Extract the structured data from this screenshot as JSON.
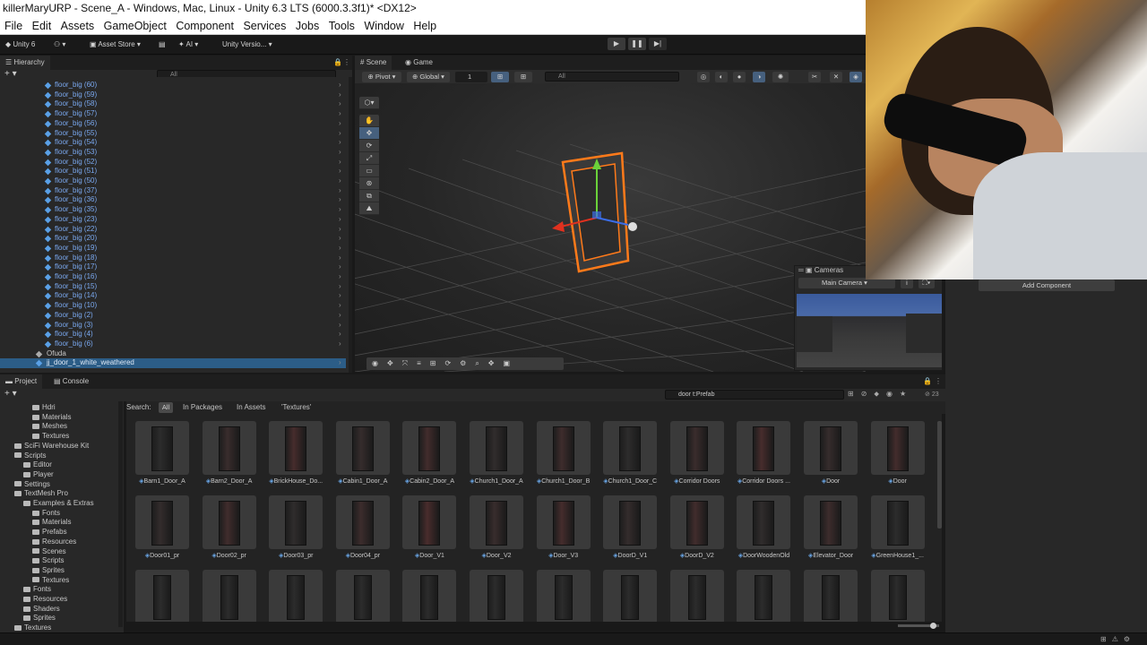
{
  "title": "killerMaryURP - Scene_A - Windows, Mac, Linux - Unity 6.3 LTS (6000.3.3f1)* <DX12>",
  "menu": [
    "File",
    "Edit",
    "Assets",
    "GameObject",
    "Component",
    "Services",
    "Jobs",
    "Tools",
    "Window",
    "Help"
  ],
  "toolbar": {
    "unity": "Unity 6",
    "asset_store": "Asset Store",
    "ai": "AI",
    "version": "Unity Versio..."
  },
  "hierarchy": {
    "tab": "Hierarchy",
    "search_placeholder": "All",
    "items": [
      "floor_big (60)",
      "floor_big (59)",
      "floor_big (58)",
      "floor_big (57)",
      "floor_big (56)",
      "floor_big (55)",
      "floor_big (54)",
      "floor_big (53)",
      "floor_big (52)",
      "floor_big (51)",
      "floor_big (50)",
      "floor_big (37)",
      "floor_big (36)",
      "floor_big (35)",
      "floor_big (23)",
      "floor_big (22)",
      "floor_big (20)",
      "floor_big (19)",
      "floor_big (18)",
      "floor_big (17)",
      "floor_big (16)",
      "floor_big (15)",
      "floor_big (14)",
      "floor_big (10)",
      "floor_big (2)",
      "floor_big (3)",
      "floor_big (4)",
      "floor_big (6)"
    ],
    "ofuda": "Ofuda",
    "door": "jj_door_1_white_weathered"
  },
  "scene": {
    "tab_scene": "Scene",
    "tab_game": "Game",
    "pivot": "Pivot",
    "global": "Global",
    "grid_value": "1",
    "search_placeholder": "All"
  },
  "cameras": {
    "title": "Cameras",
    "selected": "Main Camera"
  },
  "inspector": {
    "add_component": "Add Component"
  },
  "project": {
    "tab_project": "Project",
    "tab_console": "Console",
    "search_value": "door t:Prefab",
    "count": "23",
    "filter_label": "Search:",
    "filters": [
      "All",
      "In Packages",
      "In Assets",
      "'Textures'"
    ],
    "tree": [
      {
        "name": "Hdri",
        "indent": 3
      },
      {
        "name": "Materials",
        "indent": 3
      },
      {
        "name": "Meshes",
        "indent": 3
      },
      {
        "name": "Textures",
        "indent": 3
      },
      {
        "name": "SciFi Warehouse Kit",
        "indent": 1
      },
      {
        "name": "Scripts",
        "indent": 1
      },
      {
        "name": "Editor",
        "indent": 2
      },
      {
        "name": "Player",
        "indent": 2
      },
      {
        "name": "Settings",
        "indent": 1
      },
      {
        "name": "TextMesh Pro",
        "indent": 1
      },
      {
        "name": "Examples & Extras",
        "indent": 2
      },
      {
        "name": "Fonts",
        "indent": 3
      },
      {
        "name": "Materials",
        "indent": 3
      },
      {
        "name": "Prefabs",
        "indent": 3
      },
      {
        "name": "Resources",
        "indent": 3
      },
      {
        "name": "Scenes",
        "indent": 3
      },
      {
        "name": "Scripts",
        "indent": 3
      },
      {
        "name": "Sprites",
        "indent": 3
      },
      {
        "name": "Textures",
        "indent": 3
      },
      {
        "name": "Fonts",
        "indent": 2
      },
      {
        "name": "Resources",
        "indent": 2
      },
      {
        "name": "Shaders",
        "indent": 2
      },
      {
        "name": "Sprites",
        "indent": 2
      },
      {
        "name": "Textures",
        "indent": 1
      }
    ],
    "assets_row1": [
      "Barn1_Door_A",
      "Barn2_Door_A",
      "BrickHouse_Do...",
      "Cabin1_Door_A",
      "Cabin2_Door_A",
      "Church1_Door_A",
      "Church1_Door_B",
      "Church1_Door_C",
      "Corridor Doors",
      "Corridor Doors ...",
      "Door",
      "Door"
    ],
    "assets_row2": [
      "Door01_pr",
      "Door02_pr",
      "Door03_pr",
      "Door04_pr",
      "Door_V1",
      "Door_V2",
      "Door_V3",
      "DoorD_V1",
      "DoorD_V2",
      "DoorWoodenOld",
      "Elevator_Door",
      "GreenHouse1_..."
    ]
  }
}
